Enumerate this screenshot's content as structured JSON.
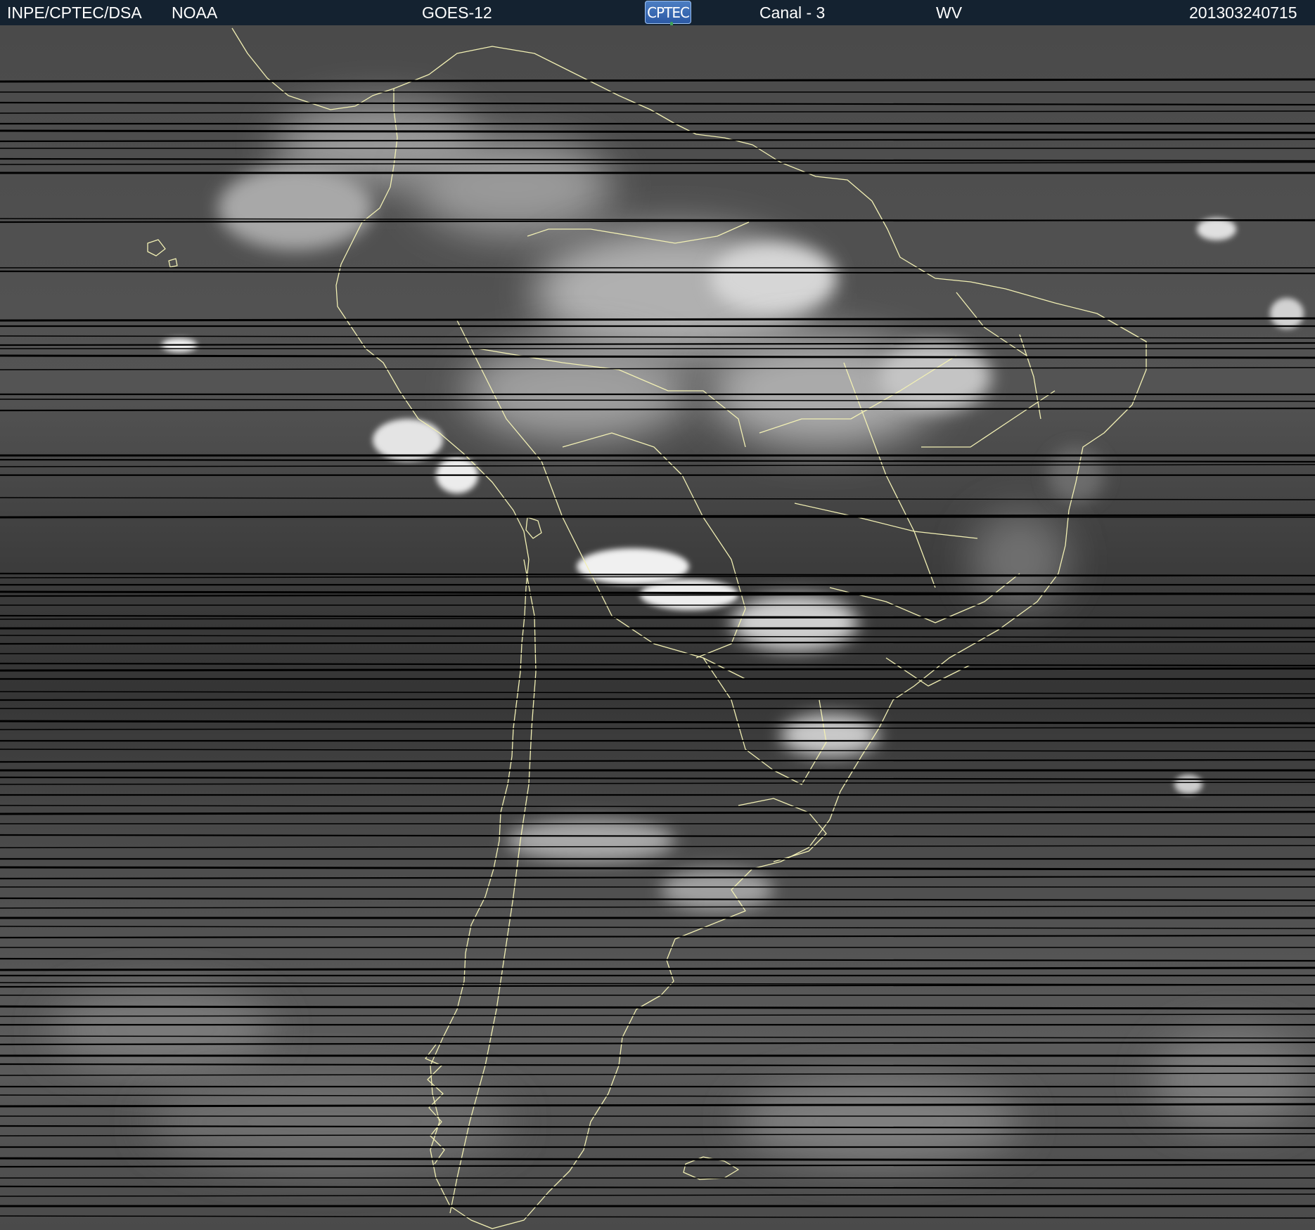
{
  "header": {
    "institution": "INPE/CPTEC/DSA",
    "agency": "NOAA",
    "satellite": "GOES-12",
    "logo_text": "CPTEC",
    "channel": "Canal - 3",
    "band": "WV",
    "timestamp": "201303240715"
  },
  "imagery": {
    "product": "water vapor satellite image",
    "region": "South America",
    "palette": "grayscale",
    "coastline_color": "#f2f0b4",
    "scanline_gap_color": "#000000"
  },
  "colors": {
    "header_background": "#142230",
    "header_text": "#ffffff",
    "logo_background": "#3566b0"
  }
}
